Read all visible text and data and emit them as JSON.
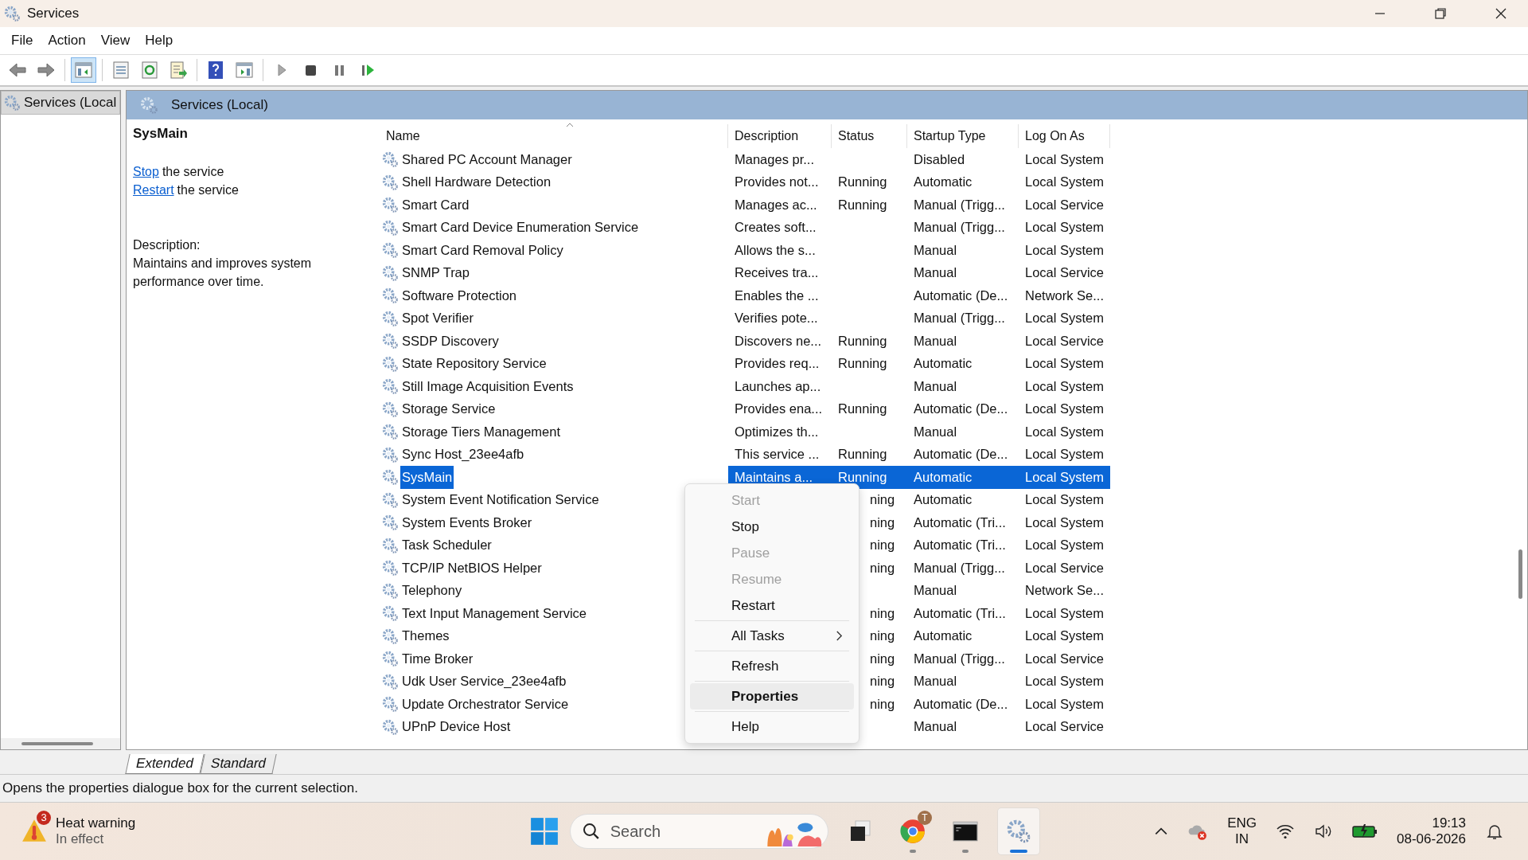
{
  "window": {
    "title": "Services"
  },
  "menu_bar": [
    "File",
    "Action",
    "View",
    "Help"
  ],
  "toolbar": [
    {
      "kind": "back",
      "pressed": false
    },
    {
      "kind": "forward",
      "pressed": false
    },
    {
      "kind": "sep"
    },
    {
      "kind": "tree",
      "pressed": true
    },
    {
      "kind": "sep"
    },
    {
      "kind": "properties",
      "pressed": false
    },
    {
      "kind": "refresh",
      "pressed": false
    },
    {
      "kind": "export",
      "pressed": false
    },
    {
      "kind": "sep"
    },
    {
      "kind": "help",
      "pressed": false
    },
    {
      "kind": "console",
      "pressed": false
    },
    {
      "kind": "sep"
    },
    {
      "kind": "play",
      "pressed": false
    },
    {
      "kind": "stop",
      "pressed": false
    },
    {
      "kind": "pause",
      "pressed": false
    },
    {
      "kind": "resume",
      "pressed": false
    }
  ],
  "tree": {
    "items": [
      {
        "label": "Services (Local",
        "selected": true
      }
    ]
  },
  "panel_title": "Services (Local)",
  "details": {
    "service_name": "SysMain",
    "actions": [
      {
        "link": "Stop",
        "text": "the service"
      },
      {
        "link": "Restart",
        "text": "the service"
      }
    ],
    "description_label": "Description:",
    "description": "Maintains and improves system performance over time."
  },
  "table": {
    "columns": [
      "Name",
      "Description",
      "Status",
      "Startup Type",
      "Log On As"
    ],
    "rows": [
      {
        "name": "Shared PC Account Manager",
        "description": "Manages pr...",
        "startup": "Disabled",
        "logon": "Local System",
        "selected": false
      },
      {
        "name": "Shell Hardware Detection",
        "description": "Provides not...",
        "status": "Running",
        "startup": "Automatic",
        "logon": "Local System",
        "selected": false
      },
      {
        "name": "Smart Card",
        "description": "Manages ac...",
        "status": "Running",
        "startup": "Manual (Trigg...",
        "logon": "Local Service",
        "selected": false
      },
      {
        "name": "Smart Card Device Enumeration Service",
        "description": "Creates soft...",
        "startup": "Manual (Trigg...",
        "logon": "Local System",
        "selected": false
      },
      {
        "name": "Smart Card Removal Policy",
        "description": "Allows the s...",
        "startup": "Manual",
        "logon": "Local System",
        "selected": false
      },
      {
        "name": "SNMP Trap",
        "description": "Receives tra...",
        "startup": "Manual",
        "logon": "Local Service",
        "selected": false
      },
      {
        "name": "Software Protection",
        "description": "Enables the ...",
        "startup": "Automatic (De...",
        "logon": "Network Se...",
        "selected": false
      },
      {
        "name": "Spot Verifier",
        "description": "Verifies pote...",
        "startup": "Manual (Trigg...",
        "logon": "Local System",
        "selected": false
      },
      {
        "name": "SSDP Discovery",
        "description": "Discovers ne...",
        "status": "Running",
        "startup": "Manual",
        "logon": "Local Service",
        "selected": false
      },
      {
        "name": "State Repository Service",
        "description": "Provides req...",
        "status": "Running",
        "startup": "Automatic",
        "logon": "Local System",
        "selected": false
      },
      {
        "name": "Still Image Acquisition Events",
        "description": "Launches ap...",
        "startup": "Manual",
        "logon": "Local System",
        "selected": false
      },
      {
        "name": "Storage Service",
        "description": "Provides ena...",
        "status": "Running",
        "startup": "Automatic (De...",
        "logon": "Local System",
        "selected": false
      },
      {
        "name": "Storage Tiers Management",
        "description": "Optimizes th...",
        "startup": "Manual",
        "logon": "Local System",
        "selected": false
      },
      {
        "name": "Sync Host_23ee4afb",
        "description": "This service ...",
        "status": "Running",
        "startup": "Automatic (De...",
        "logon": "Local System",
        "selected": false
      },
      {
        "name": "SysMain",
        "description": "Maintains a...",
        "status": "Running",
        "startup": "Automatic",
        "logon": "Local System",
        "selected": true
      },
      {
        "name": "System Event Notification Service",
        "covered": true,
        "status": "ning",
        "startup": "Automatic",
        "logon": "Local System",
        "selected": false
      },
      {
        "name": "System Events Broker",
        "covered": true,
        "status": "ning",
        "startup": "Automatic (Tri...",
        "logon": "Local System",
        "selected": false
      },
      {
        "name": "Task Scheduler",
        "covered": true,
        "status": "ning",
        "startup": "Automatic (Tri...",
        "logon": "Local System",
        "selected": false
      },
      {
        "name": "TCP/IP NetBIOS Helper",
        "covered": true,
        "status": "ning",
        "startup": "Manual (Trigg...",
        "logon": "Local Service",
        "selected": false
      },
      {
        "name": "Telephony",
        "covered": true,
        "startup": "Manual",
        "logon": "Network Se...",
        "selected": false
      },
      {
        "name": "Text Input Management Service",
        "covered": true,
        "status": "ning",
        "startup": "Automatic (Tri...",
        "logon": "Local System",
        "selected": false
      },
      {
        "name": "Themes",
        "covered": true,
        "status": "ning",
        "startup": "Automatic",
        "logon": "Local System",
        "selected": false
      },
      {
        "name": "Time Broker",
        "covered": true,
        "status": "ning",
        "startup": "Manual (Trigg...",
        "logon": "Local Service",
        "selected": false
      },
      {
        "name": "Udk User Service_23ee4afb",
        "covered": true,
        "status": "ning",
        "startup": "Manual",
        "logon": "Local System",
        "selected": false
      },
      {
        "name": "Update Orchestrator Service",
        "covered": true,
        "status": "ning",
        "startup": "Automatic (De...",
        "logon": "Local System",
        "selected": false
      },
      {
        "name": "UPnP Device Host",
        "covered": true,
        "startup": "Manual",
        "logon": "Local Service",
        "selected": false
      }
    ]
  },
  "view_tabs": [
    {
      "label": "Extended",
      "selected": true
    },
    {
      "label": "Standard",
      "selected": false
    }
  ],
  "context_menu": {
    "items": [
      {
        "kind": "item",
        "label": "Start",
        "disabled": true,
        "selected": false
      },
      {
        "kind": "item",
        "label": "Stop",
        "disabled": false,
        "selected": false
      },
      {
        "kind": "item",
        "label": "Pause",
        "disabled": true,
        "selected": false
      },
      {
        "kind": "item",
        "label": "Resume",
        "disabled": true,
        "selected": false
      },
      {
        "kind": "item",
        "label": "Restart",
        "disabled": false,
        "selected": false
      },
      {
        "kind": "separator"
      },
      {
        "kind": "submenu",
        "label": "All Tasks",
        "disabled": false,
        "selected": false
      },
      {
        "kind": "separator"
      },
      {
        "kind": "item",
        "label": "Refresh",
        "disabled": false,
        "selected": false
      },
      {
        "kind": "separator"
      },
      {
        "kind": "default",
        "label": "Properties",
        "disabled": false,
        "selected": true
      },
      {
        "kind": "separator"
      },
      {
        "kind": "item",
        "label": "Help",
        "disabled": false,
        "selected": false
      }
    ]
  },
  "status_bar": "Opens the properties dialogue box for the current selection.",
  "taskbar": {
    "weather": {
      "badge": "3",
      "title": "Heat warning",
      "subtitle": "In effect"
    },
    "search": {
      "placeholder": "Search"
    },
    "apps": [
      {
        "kind": "taskview",
        "running": false,
        "selected": false
      },
      {
        "kind": "browser",
        "badge": "T",
        "running": true,
        "selected": false
      },
      {
        "kind": "terminal",
        "running": true,
        "selected": false
      },
      {
        "kind": "services",
        "running": true,
        "selected": true
      }
    ],
    "language": [
      "ENG",
      "IN"
    ],
    "time": "19:13",
    "date": "08-06-2026"
  }
}
